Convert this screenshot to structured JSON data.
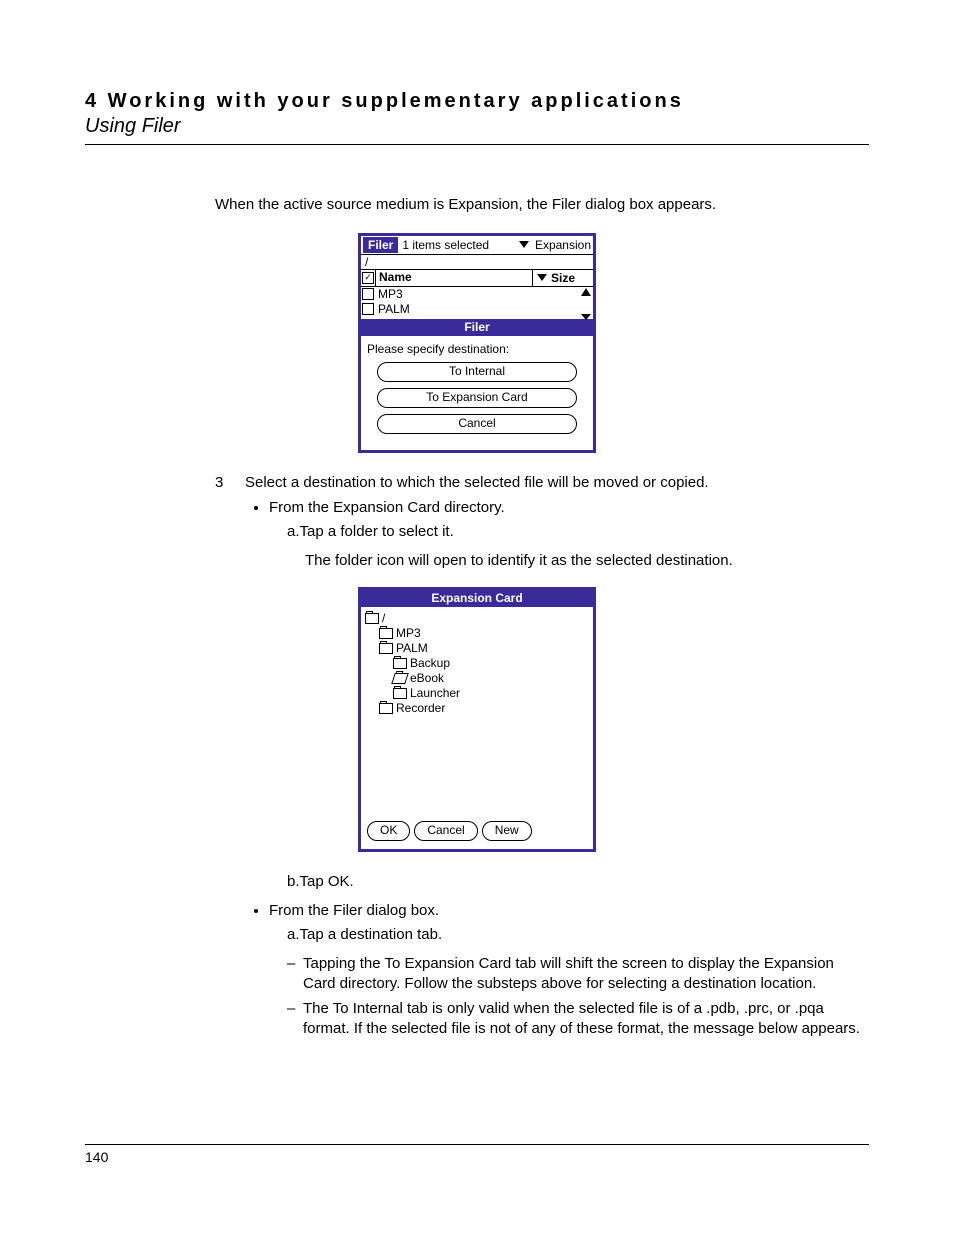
{
  "header": {
    "chapter": "4 Working with your supplementary applications",
    "section": "Using Filer"
  },
  "intro": "When the active source medium is Expansion, the Filer dialog box appears.",
  "step": {
    "num": "3",
    "text": "Select a destination to which the selected file will be moved or copied.",
    "bullets": {
      "b1": "From the Expansion Card directory.",
      "b1a": "a.Tap a folder to select it.",
      "b1a_note": "The folder icon will open to identify it as the selected destination.",
      "b1b": "b.Tap OK.",
      "b2": "From the Filer dialog box.",
      "b2a": "a.Tap a destination tab.",
      "b2a_d1": "Tapping the To Expansion Card tab will shift the screen to display the Expansion Card directory. Follow the substeps above for selecting a destination location.",
      "b2a_d2": "The To Internal tab is only valid when the selected file is of a .pdb, .prc, or .pqa format. If the selected file is not of any of these format, the message below appears."
    }
  },
  "filer": {
    "badge": "Filer",
    "selected": "1 items selected",
    "medium": "Expansion",
    "path": "/",
    "col_name": "Name",
    "col_size": "Size",
    "rows": {
      "r1": "MP3",
      "r2": "PALM"
    },
    "modal_title": "Filer",
    "modal_prompt": "Please specify destination:",
    "btn_internal": "To Internal",
    "btn_expcard": "To Expansion Card",
    "btn_cancel": "Cancel"
  },
  "expcard": {
    "title": "Expansion Card",
    "root": "/",
    "n1": "MP3",
    "n2": "PALM",
    "n2a": "Backup",
    "n2b": "eBook",
    "n2c": "Launcher",
    "n3": "Recorder",
    "btn_ok": "OK",
    "btn_cancel": "Cancel",
    "btn_new": "New"
  },
  "page_number": "140"
}
